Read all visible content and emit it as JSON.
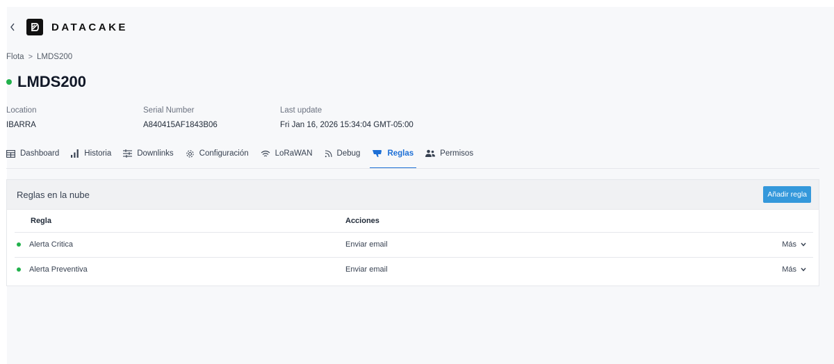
{
  "header": {
    "logo_text": "DATACAKE",
    "back_icon": "chevron-left-icon"
  },
  "breadcrumb": {
    "items": [
      "Flota",
      "LMDS200"
    ],
    "separator": ">"
  },
  "device": {
    "name": "LMDS200",
    "status_color": "#22b14c"
  },
  "meta": {
    "location_label": "Location",
    "location_value": "IBARRA",
    "serial_label": "Serial Number",
    "serial_value": "A840415AF1843B06",
    "update_label": "Last update",
    "update_value": "Fri Jan 16, 2026 15:34:04 GMT-05:00"
  },
  "tabs": [
    {
      "label": "Dashboard",
      "icon": "table-icon"
    },
    {
      "label": "Historia",
      "icon": "bar-chart-icon"
    },
    {
      "label": "Downlinks",
      "icon": "sliders-icon"
    },
    {
      "label": "Configuración",
      "icon": "gear-icon"
    },
    {
      "label": "LoRaWAN",
      "icon": "wifi-icon"
    },
    {
      "label": "Debug",
      "icon": "rss-icon"
    },
    {
      "label": "Reglas",
      "icon": "thumbs-down-icon",
      "active": true
    },
    {
      "label": "Permisos",
      "icon": "users-icon"
    }
  ],
  "rules_card": {
    "title": "Reglas en la nube",
    "add_button": "Añadir regla",
    "columns": [
      "Regla",
      "Acciones"
    ],
    "rows": [
      {
        "name": "Alerta Critica",
        "action": "Enviar email",
        "more": "Más"
      },
      {
        "name": "Alerta Preventiva",
        "action": "Enviar email",
        "more": "Más"
      }
    ]
  },
  "colors": {
    "accent": "#1d6fd6",
    "button": "#3498db",
    "status_green": "#22b14c"
  }
}
